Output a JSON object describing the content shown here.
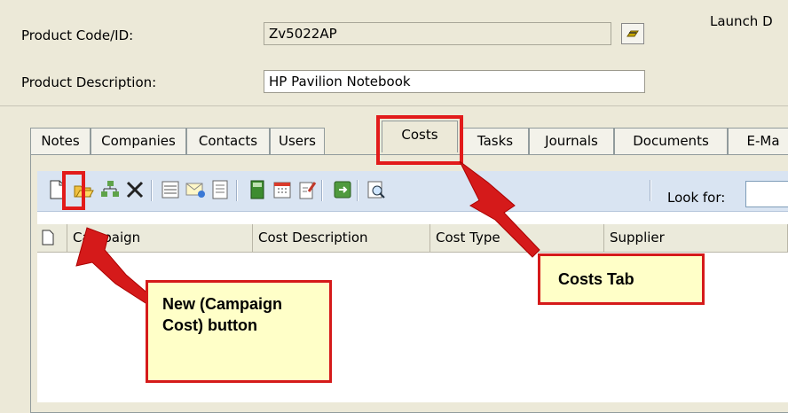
{
  "form": {
    "product_code_label": "Product Code/ID:",
    "product_code_value": "Zv5022AP",
    "product_description_label": "Product Description:",
    "product_description_value": "HP Pavilion Notebook",
    "launch_date_label": "Launch D"
  },
  "tabs": [
    {
      "label": "Notes",
      "active": false
    },
    {
      "label": "Companies",
      "active": false
    },
    {
      "label": "Contacts",
      "active": false
    },
    {
      "label": "Users",
      "active": false
    },
    {
      "label": "Costs",
      "active": true
    },
    {
      "label": "Tasks",
      "active": false
    },
    {
      "label": "Journals",
      "active": false
    },
    {
      "label": "Documents",
      "active": false
    },
    {
      "label": "E-Ma",
      "active": false
    }
  ],
  "toolbar": {
    "icons": [
      "new-icon",
      "open-folder-icon",
      "link-icon",
      "delete-icon",
      "list-view-icon",
      "email-icon",
      "form-icon",
      "book-icon",
      "calendar-icon",
      "edit-document-icon",
      "export-icon",
      "search-icon"
    ],
    "look_for_label": "Look for:",
    "search_value": ""
  },
  "grid": {
    "columns": [
      "Campaign",
      "Cost Description",
      "Cost Type",
      "Supplier"
    ]
  },
  "callouts": {
    "new_button": "New (Campaign Cost) button",
    "costs_tab": "Costs Tab"
  },
  "colors": {
    "annotation_red": "#e21b1b",
    "callout_fill": "#ffffc8",
    "toolbar_bg": "#d9e4f2",
    "window_bg": "#ece9d8"
  }
}
